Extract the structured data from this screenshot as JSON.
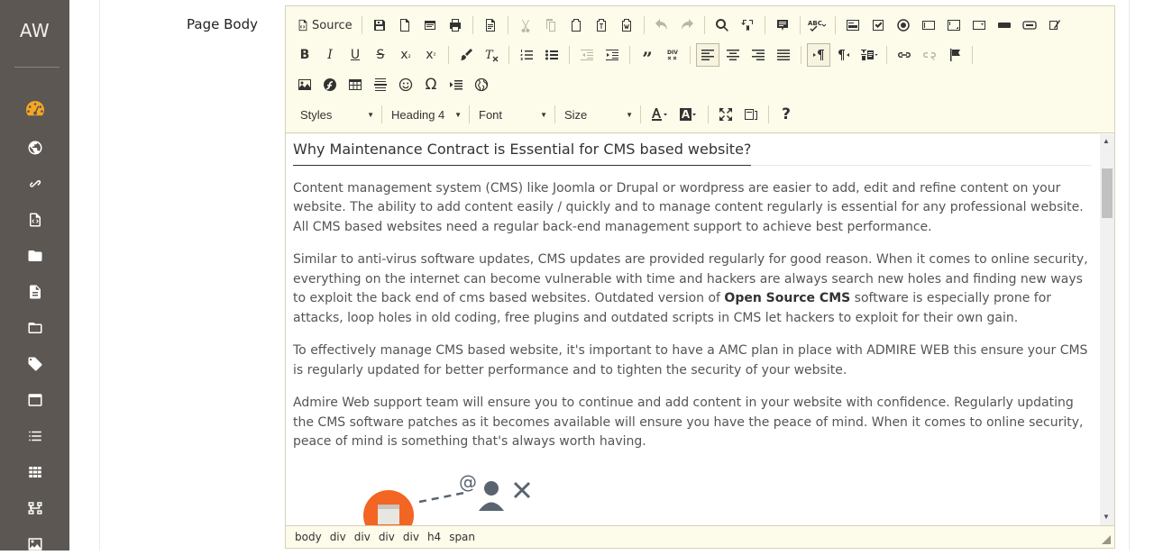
{
  "brand": "AW",
  "sidebar": {
    "icons": [
      "dashboard-icon",
      "globe-icon",
      "link-icon",
      "code-file-icon",
      "folder-icon",
      "document-icon",
      "folder-outline-icon",
      "tags-icon",
      "window-icon",
      "list-icon",
      "grid-icon",
      "sitemap-icon",
      "image-icon"
    ]
  },
  "field_label": "Page Body",
  "toolbar": {
    "source_label": "Source",
    "styles_label": "Styles",
    "format_label": "Heading 4",
    "font_label": "Font",
    "size_label": "Size"
  },
  "content": {
    "heading": "Why Maintenance Contract is Essential for CMS based website?",
    "p1": "Content management system (CMS) like Joomla or Drupal or wordpress are easier to add, edit and refine content on your website. The ability to add content easily / quickly and to manage content regularly is essential for any professional website. All CMS based websites need a regular back-end management support to achieve best performance.",
    "p2_before": "Similar to anti-virus software updates, CMS updates are provided regularly for good reason. When it comes to online security, everything on the internet can become vulnerable with time and hackers are always search new holes and finding new ways to exploit the back end of cms based websites. Outdated version of ",
    "p2_strong": "Open Source CMS",
    "p2_after": " software is especially prone for attacks, loop holes in old coding, free plugins and outdated scripts in CMS let hackers to exploit for their own gain.",
    "p3": "To effectively manage CMS based website, it's important to have a AMC plan in place with ADMIRE WEB this ensure your CMS is regularly updated for better performance and to tighten the security of your website.",
    "p4": "Admire Web support team will ensure you to continue and add content in your website with confidence. Regularly updating the CMS software patches as it becomes available will ensure you have the peace of mind. When it comes to online security, peace of mind is something that's always worth having."
  },
  "statusbar": {
    "crumbs": [
      "body",
      "div",
      "div",
      "div",
      "div",
      "h4",
      "span"
    ]
  },
  "colors": {
    "sidebar_bg": "#5c5752",
    "accent": "#f5a623",
    "toolbar_bg": "#fdfbe9",
    "illustration_orange": "#f26522",
    "illustration_gray": "#5a6470"
  }
}
